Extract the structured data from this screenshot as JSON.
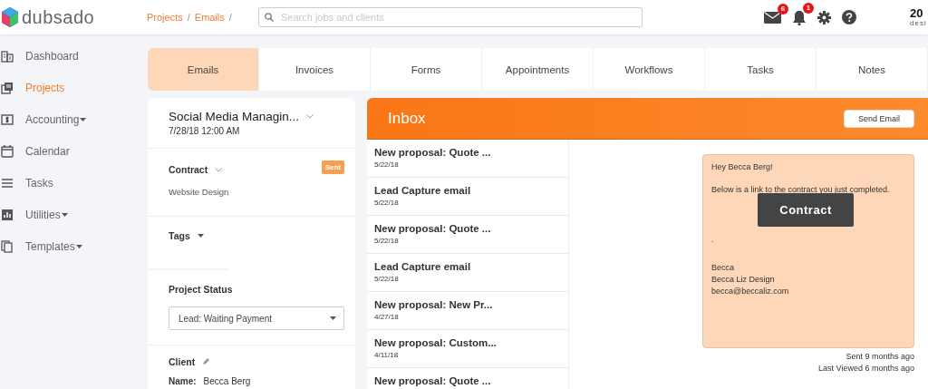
{
  "header": {
    "logo": "dubsado",
    "breadcrumbs": [
      {
        "label": "Projects",
        "separator": "/"
      },
      {
        "label": "Emails",
        "separator": "/"
      }
    ],
    "search": {
      "placeholder": "Search jobs and clients"
    },
    "mail_count": "6",
    "notification_count": "1",
    "brand_text": "20",
    "brand_subtext": "desi"
  },
  "sidebar": {
    "items": [
      {
        "label": "Dashboard",
        "selected": false,
        "dropdown": false
      },
      {
        "label": "Projects",
        "selected": true,
        "dropdown": false
      },
      {
        "label": "Accounting",
        "selected": false,
        "dropdown": true
      },
      {
        "label": "Calendar",
        "selected": false,
        "dropdown": false
      },
      {
        "label": "Tasks",
        "selected": false,
        "dropdown": false
      },
      {
        "label": "Utilities",
        "selected": false,
        "dropdown": true
      },
      {
        "label": "Templates",
        "selected": false,
        "dropdown": true
      }
    ]
  },
  "tabs": [
    {
      "label": "Emails",
      "selected": true
    },
    {
      "label": "Invoices",
      "selected": false
    },
    {
      "label": "Forms",
      "selected": false
    },
    {
      "label": "Appointments",
      "selected": false
    },
    {
      "label": "Workflows",
      "selected": false
    },
    {
      "label": "Tasks",
      "selected": false
    },
    {
      "label": "Notes",
      "selected": false
    }
  ],
  "project": {
    "title": "Social Media Managin...",
    "date": "7/28/18 12:00 AM",
    "contract": {
      "heading": "Contract",
      "badge": "Sent",
      "name": "Website Design"
    },
    "tags": {
      "heading": "Tags"
    },
    "status": {
      "heading": "Project Status",
      "value": "Lead: Waiting Payment"
    },
    "client": {
      "heading": "Client",
      "name_label": "Name:",
      "name": "Becca Berg"
    }
  },
  "inbox": {
    "title": "Inbox",
    "send_button": "Send Email",
    "emails": [
      {
        "subject": "New proposal: Quote ...",
        "date": "5/22/18"
      },
      {
        "subject": "Lead Capture email",
        "date": "5/22/18"
      },
      {
        "subject": "New proposal: Quote ...",
        "date": "5/22/18"
      },
      {
        "subject": "Lead Capture email",
        "date": "5/22/18"
      },
      {
        "subject": "New proposal: New Pr...",
        "date": "4/27/18"
      },
      {
        "subject": "New proposal: Custom...",
        "date": "4/11/18"
      },
      {
        "subject": "New proposal: Quote ..."
      }
    ],
    "message": {
      "greeting": "Hey Becca Berg!",
      "intro": "Below is a link to the contract you just completed.",
      "button": "Contract",
      "after_button": ".",
      "signature": [
        "Becca",
        "Becca Liz Design",
        "becca@beccaliz.com"
      ],
      "sent": "Sent 9 months ago",
      "viewed": "Last Viewed 6 months ago"
    }
  }
}
